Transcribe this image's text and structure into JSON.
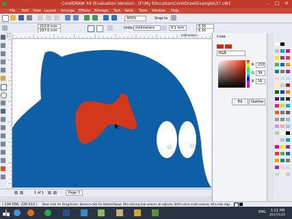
{
  "window": {
    "title": "CorelDRAW X4 (Evaluation Version) - [F:\\My Education\\CorelDraw\\Example\\37.cdr]",
    "minimize": "–",
    "maximize": "□",
    "close": "✕"
  },
  "menu": [
    "File",
    "Edit",
    "View",
    "Layout",
    "Arrange",
    "Effects",
    "Bitmaps",
    "Text",
    "Table",
    "Tools",
    "Window",
    "Help"
  ],
  "toolbar": {
    "zoom_value": "400%",
    "snap_label": "Snap to"
  },
  "property_bar": {
    "x_value": "210.0 mm",
    "y_value": "297.0 mm",
    "units_label": "Units:",
    "units_value": "millimeters",
    "nudge_value": "0.1 mm",
    "dup_x_value": "6.35 mm",
    "dup_y_value": "6.35 mm"
  },
  "ruler_unit": "millimeters",
  "docker": {
    "title": "Color",
    "model": "RGB",
    "r_label": "R",
    "r_value": "210",
    "g_label": "G",
    "g_value": "39",
    "b_label": "B",
    "b_value": "16",
    "fill_button": "Fill",
    "outline_button": "Outline",
    "current_color": "#d2270f"
  },
  "page_nav": {
    "counter": "1 of 1",
    "page_tab": "Page 1"
  },
  "status": {
    "coordinates": "( 134.056, 226.512 )",
    "hint": "Next click for Drag/Scale; Second click for Rotate/Skew; Dbl-clicking tool selects all objects; Shift+click multi-selects; Alt+click digs"
  },
  "taskbar": {
    "language": "ENG",
    "time": "1:11 PM",
    "date": "2017/1/22"
  },
  "colors": {
    "shape_blue": "#0f5fa6",
    "bow_red": "#d2381a",
    "title_red": "#c0392b"
  },
  "icons": [
    "pick-tool-icon",
    "shape-tool-icon",
    "crop-tool-icon",
    "zoom-tool-icon",
    "freehand-tool-icon",
    "smart-fill-icon",
    "rectangle-tool-icon",
    "ellipse-tool-icon",
    "polygon-tool-icon",
    "text-tool-icon",
    "table-tool-icon",
    "dimension-tool-icon",
    "connector-tool-icon",
    "blend-tool-icon",
    "eyedropper-icon",
    "outline-pen-icon",
    "fill-tool-icon",
    "interactive-fill-icon"
  ]
}
